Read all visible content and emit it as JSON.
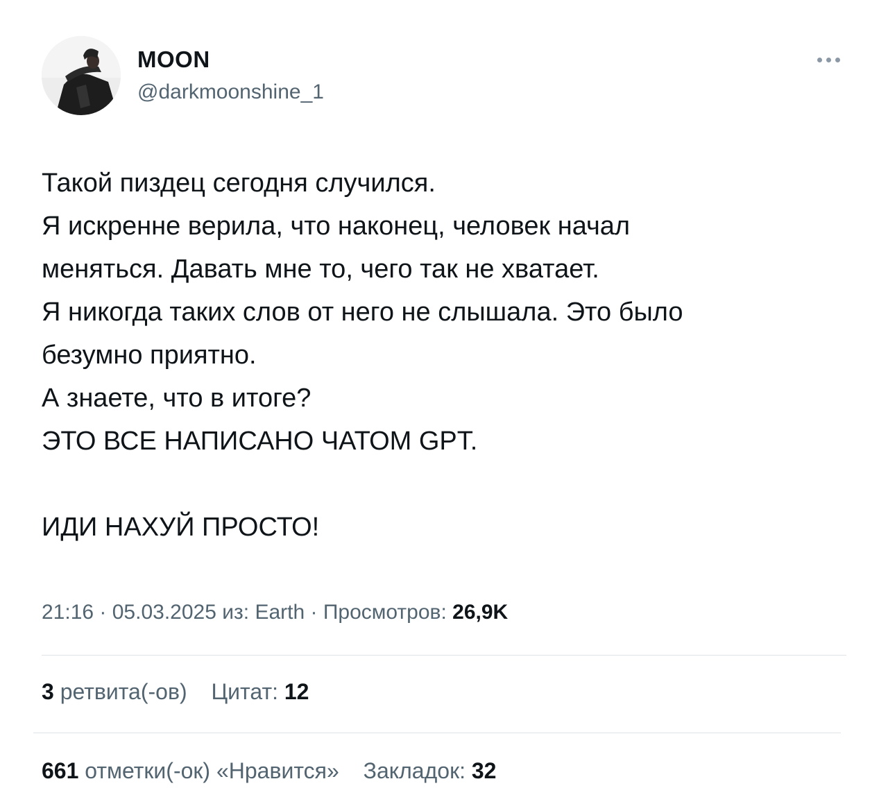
{
  "author": {
    "display_name": "MOON",
    "handle": "@darkmoonshine_1",
    "avatar_icon": "profile-photo"
  },
  "more_icon": "ellipsis-icon",
  "tweet": {
    "lines": [
      "Такой пиздец сегодня случился.",
      "Я искренне верила, что наконец, человек начал",
      "меняться. Давать мне то, чего так не хватает.",
      "Я никогда таких слов от него не слышала. Это было",
      "безумно приятно.",
      "А знаете, что в итоге?",
      "ЭТО ВСЕ НАПИСАНО ЧАТОМ GPT.",
      "",
      "ИДИ НАХУЙ ПРОСТО!"
    ]
  },
  "meta": {
    "time": "21:16",
    "separator": " · ",
    "date": "05.03.2025",
    "source_prefix": " из: ",
    "source": "Earth",
    "views_label": "Просмотров: ",
    "views_value": "26,9K"
  },
  "stats": {
    "retweets_count": "3",
    "retweets_label": " ретвита(-ов)",
    "quotes_label": "Цитат: ",
    "quotes_count": "12",
    "likes_count": "661",
    "likes_label": " отметки(-ок) «Нравится»",
    "bookmarks_label": "Закладок: ",
    "bookmarks_count": "32"
  }
}
